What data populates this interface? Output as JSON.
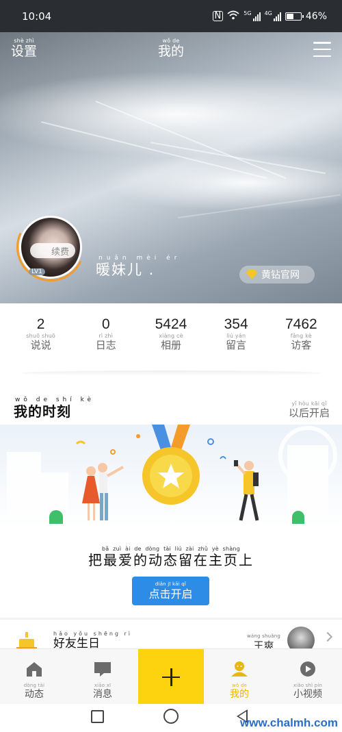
{
  "status_bar": {
    "time": "10:04",
    "network_5g": "5G",
    "network_4g": "4G",
    "battery_level": 0.46,
    "battery_text": "46%"
  },
  "header": {
    "settings": {
      "text": "设置",
      "pinyin": "shè zhì"
    },
    "title": {
      "text": "我的",
      "pinyin": "wǒ de"
    }
  },
  "profile": {
    "nickname": {
      "text": "暖妹儿 .",
      "pinyin": "nuǎn mèi ér"
    },
    "level": "LV1",
    "renew_label": "续费",
    "yellow_diamond_label": "黄钻官网"
  },
  "stats": [
    {
      "value": "2",
      "label": "说说",
      "pinyin": "shuō shuō"
    },
    {
      "value": "0",
      "label": "日志",
      "pinyin": "rì zhì"
    },
    {
      "value": "5424",
      "label": "相册",
      "pinyin": "xiàng cè"
    },
    {
      "value": "354",
      "label": "留言",
      "pinyin": "liú yán"
    },
    {
      "value": "7462",
      "label": "访客",
      "pinyin": "fǎng kè"
    }
  ],
  "moments": {
    "title": {
      "text": "我的时刻",
      "pinyin": "wǒ de shí kè"
    },
    "later": {
      "text": "以后开启",
      "pinyin": "yǐ hòu kāi qǐ"
    },
    "promo": {
      "text": "把最爱的动态留在主页上",
      "pinyin": "bǎ zuì ài de dòng tài liú zài zhǔ yè shàng"
    },
    "enable_button": {
      "text": "点击开启",
      "pinyin": "diǎn jī kāi qǐ"
    }
  },
  "birthday": {
    "label": {
      "text": "好友生日",
      "pinyin": "hǎo yǒu shēng rì"
    },
    "friend": {
      "text": "王爽",
      "pinyin": "wáng shuǎng"
    }
  },
  "tabbar": {
    "items": [
      {
        "label": "动态",
        "pinyin": "dòng tài",
        "icon": "home-icon",
        "active": false
      },
      {
        "label": "消息",
        "pinyin": "xiāo xī",
        "icon": "message-icon",
        "active": false
      },
      {
        "label": "我的",
        "pinyin": "wǒ de",
        "icon": "profile-icon",
        "active": true
      },
      {
        "label": "小视频",
        "pinyin": "xiǎo shì pín",
        "icon": "video-icon",
        "active": false
      }
    ],
    "add_icon": "plus-icon"
  },
  "watermark": "www.chalmh.com",
  "colors": {
    "accent_blue": "#2d8ce6",
    "accent_yellow": "#fdd20e",
    "active_tab": "#e8b711",
    "status_bar_bg": "#2a2d31"
  }
}
